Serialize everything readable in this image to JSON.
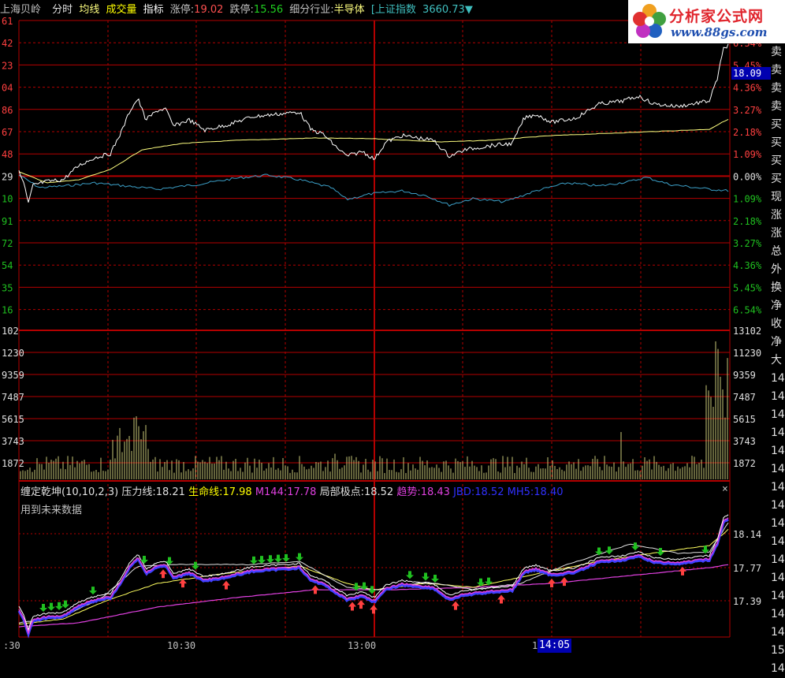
{
  "header": {
    "stock_name": "上海贝岭",
    "tabs": [
      "分时",
      "均线",
      "成交量",
      "指标"
    ],
    "limit_up_label": "涨停:",
    "limit_up_value": "19.02",
    "limit_down_label": "跌停:",
    "limit_down_value": "15.56",
    "industry_label": "细分行业:",
    "industry_value": "半导体",
    "index_name": "[上证指数",
    "index_value": "3660.73",
    "index_arrow": "▼"
  },
  "logo": {
    "title": "分析家公式网",
    "url": "www.88gs.com"
  },
  "price_axis": {
    "left": [
      "61",
      "42",
      "23",
      "04",
      "86",
      "67",
      "48",
      "29",
      "10",
      "91",
      "72",
      "54",
      "35",
      "16"
    ],
    "right_pct": [
      "6.54%",
      "5.45%",
      "4.36%",
      "3.27%",
      "2.18%",
      "1.09%",
      "0.00%",
      "1.09%",
      "2.18%",
      "3.27%",
      "4.36%",
      "5.45%",
      "6.54%"
    ],
    "current_price": "18.09"
  },
  "volume_axis": {
    "left": [
      "102",
      "1230",
      "9359",
      "7487",
      "5615",
      "3743",
      "1872"
    ],
    "right": [
      "13102",
      "11230",
      "9359",
      "7487",
      "5615",
      "3743",
      "1872"
    ]
  },
  "indicator": {
    "name": "缠定乾坤(10,10,2,3)",
    "items": [
      {
        "label": "压力线:",
        "value": "18.21"
      },
      {
        "label": "生命线:",
        "value": "17.98"
      },
      {
        "label": "M144:",
        "value": "17.78"
      },
      {
        "label": "局部极点:",
        "value": "18.52"
      },
      {
        "label": "趋势:",
        "value": "18.43"
      },
      {
        "label": "JBD:",
        "value": "18.52"
      },
      {
        "label": "MH5:",
        "value": "18.40"
      }
    ],
    "subtitle": "用到未来数据",
    "close": "×",
    "axis": [
      "18.14",
      "17.77",
      "17.39"
    ]
  },
  "time_axis": {
    "labels": [
      ":30",
      "10:30",
      "13:00",
      "14"
    ],
    "highlight": "14:05"
  },
  "right_strip": [
    "卖",
    "卖",
    "卖",
    "卖",
    "买",
    "买",
    "买",
    "买",
    "现",
    "涨",
    "涨",
    "总",
    "外",
    "换",
    "净",
    "收",
    "净",
    "大",
    "14",
    "14",
    "14",
    "14",
    "14",
    "14",
    "14",
    "14",
    "14",
    "14",
    "14",
    "14",
    "14",
    "14",
    "14",
    "15",
    "14"
  ],
  "colors": {
    "grid": "#b40000",
    "price": "#ffffff",
    "avg": "#ffff80",
    "index": "#3ca0c8",
    "volume": "#c8c878",
    "up": "#ff4040",
    "down": "#20c020",
    "magenta": "#e040e0",
    "blue": "#4040ff"
  }
}
